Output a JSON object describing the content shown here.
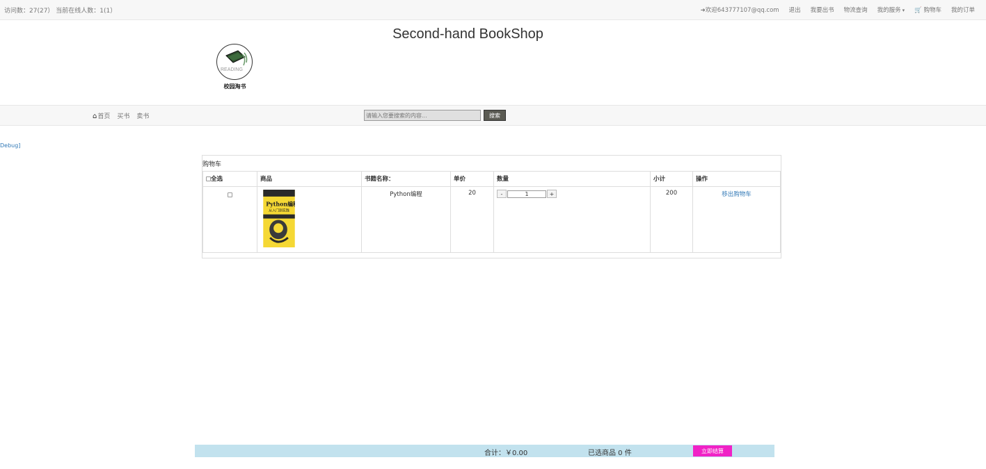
{
  "topbar": {
    "visit_text": "访问数：27(27） 当前在线人数：1(1）",
    "welcome": "欢迎643777107@qq.com",
    "logout": "退出",
    "sell_book": "我要出书",
    "logistics": "物流查询",
    "my_service": "我的服务",
    "cart": "购物车",
    "my_orders": "我的订单"
  },
  "site": {
    "title": "Second-hand BookShop"
  },
  "logo": {
    "caption": "校园淘书",
    "mark_text": "READING"
  },
  "nav": {
    "home": "首页",
    "buy": "买书",
    "sell": "卖书",
    "search_placeholder": "请输入您要搜索的内容...",
    "search_button": "搜索"
  },
  "debug": "Debug]",
  "cart": {
    "heading": "购物车",
    "columns": {
      "select_all": "全选",
      "product": "商品",
      "book_name": "书籍名称：",
      "price": "单价",
      "quantity": "数量",
      "subtotal": "小计",
      "action": "操作"
    },
    "items": [
      {
        "cover_title": "Python编程",
        "cover_subtitle": "从入门到实践",
        "name": "Python编程",
        "price": "20",
        "qty_minus": "-",
        "quantity": "1",
        "qty_plus": "+",
        "subtotal": "200",
        "action": "移出购物车"
      }
    ]
  },
  "footer": {
    "total": "合计：￥0.00",
    "selected": "已选商品 0 件",
    "checkout": "立即结算"
  },
  "colors": {
    "checkout": "#f022c6",
    "footer_bar": "#c2e2ee",
    "link": "#337ab7",
    "search_button": "#5a5a52"
  }
}
